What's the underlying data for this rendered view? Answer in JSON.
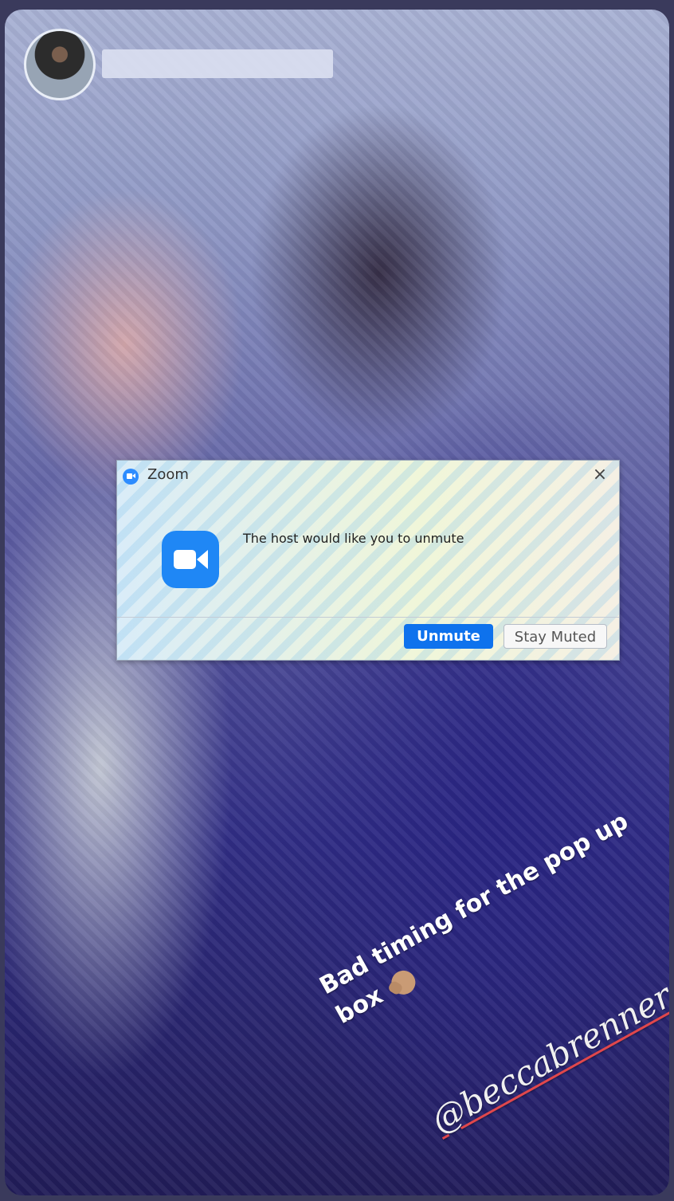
{
  "story": {
    "background": "photo of a couple kissing at a wedding"
  },
  "dialog": {
    "title": "Zoom",
    "message": "The host would like you to unmute",
    "primary_button": "Unmute",
    "secondary_button": "Stay Muted",
    "close_glyph": "×",
    "accent_color": "#0e72ed"
  },
  "caption": {
    "text": "Bad timing for the pop up box",
    "emoji": "man-facepalming",
    "mention": "@beccabrenner",
    "mention_underline_color": "#e0474c"
  },
  "icons": [
    "zoom-icon",
    "close-icon",
    "zoom-app-icon",
    "facepalm-emoji",
    "avatar"
  ]
}
